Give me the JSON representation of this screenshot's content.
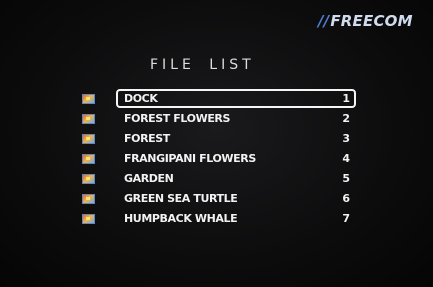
{
  "brand": {
    "prefix": "//",
    "name": "FREECOM"
  },
  "title": "FILE LIST",
  "files": [
    {
      "name": "DOCK",
      "number": "1",
      "icon": "image-file-icon",
      "selected": true
    },
    {
      "name": "FOREST FLOWERS",
      "number": "2",
      "icon": "image-file-icon",
      "selected": false
    },
    {
      "name": "FOREST",
      "number": "3",
      "icon": "image-file-icon",
      "selected": false
    },
    {
      "name": "FRANGIPANI FLOWERS",
      "number": "4",
      "icon": "image-file-icon",
      "selected": false
    },
    {
      "name": "GARDEN",
      "number": "5",
      "icon": "image-file-icon",
      "selected": false
    },
    {
      "name": "GREEN SEA TURTLE",
      "number": "6",
      "icon": "image-file-icon",
      "selected": false
    },
    {
      "name": "HUMPBACK WHALE",
      "number": "7",
      "icon": "image-file-icon",
      "selected": false
    }
  ],
  "colors": {
    "background": "#0c0c0d",
    "text": "#f2f2f2",
    "brand_accent": "#4f7fd0",
    "selection_border": "#f5f5f5"
  }
}
